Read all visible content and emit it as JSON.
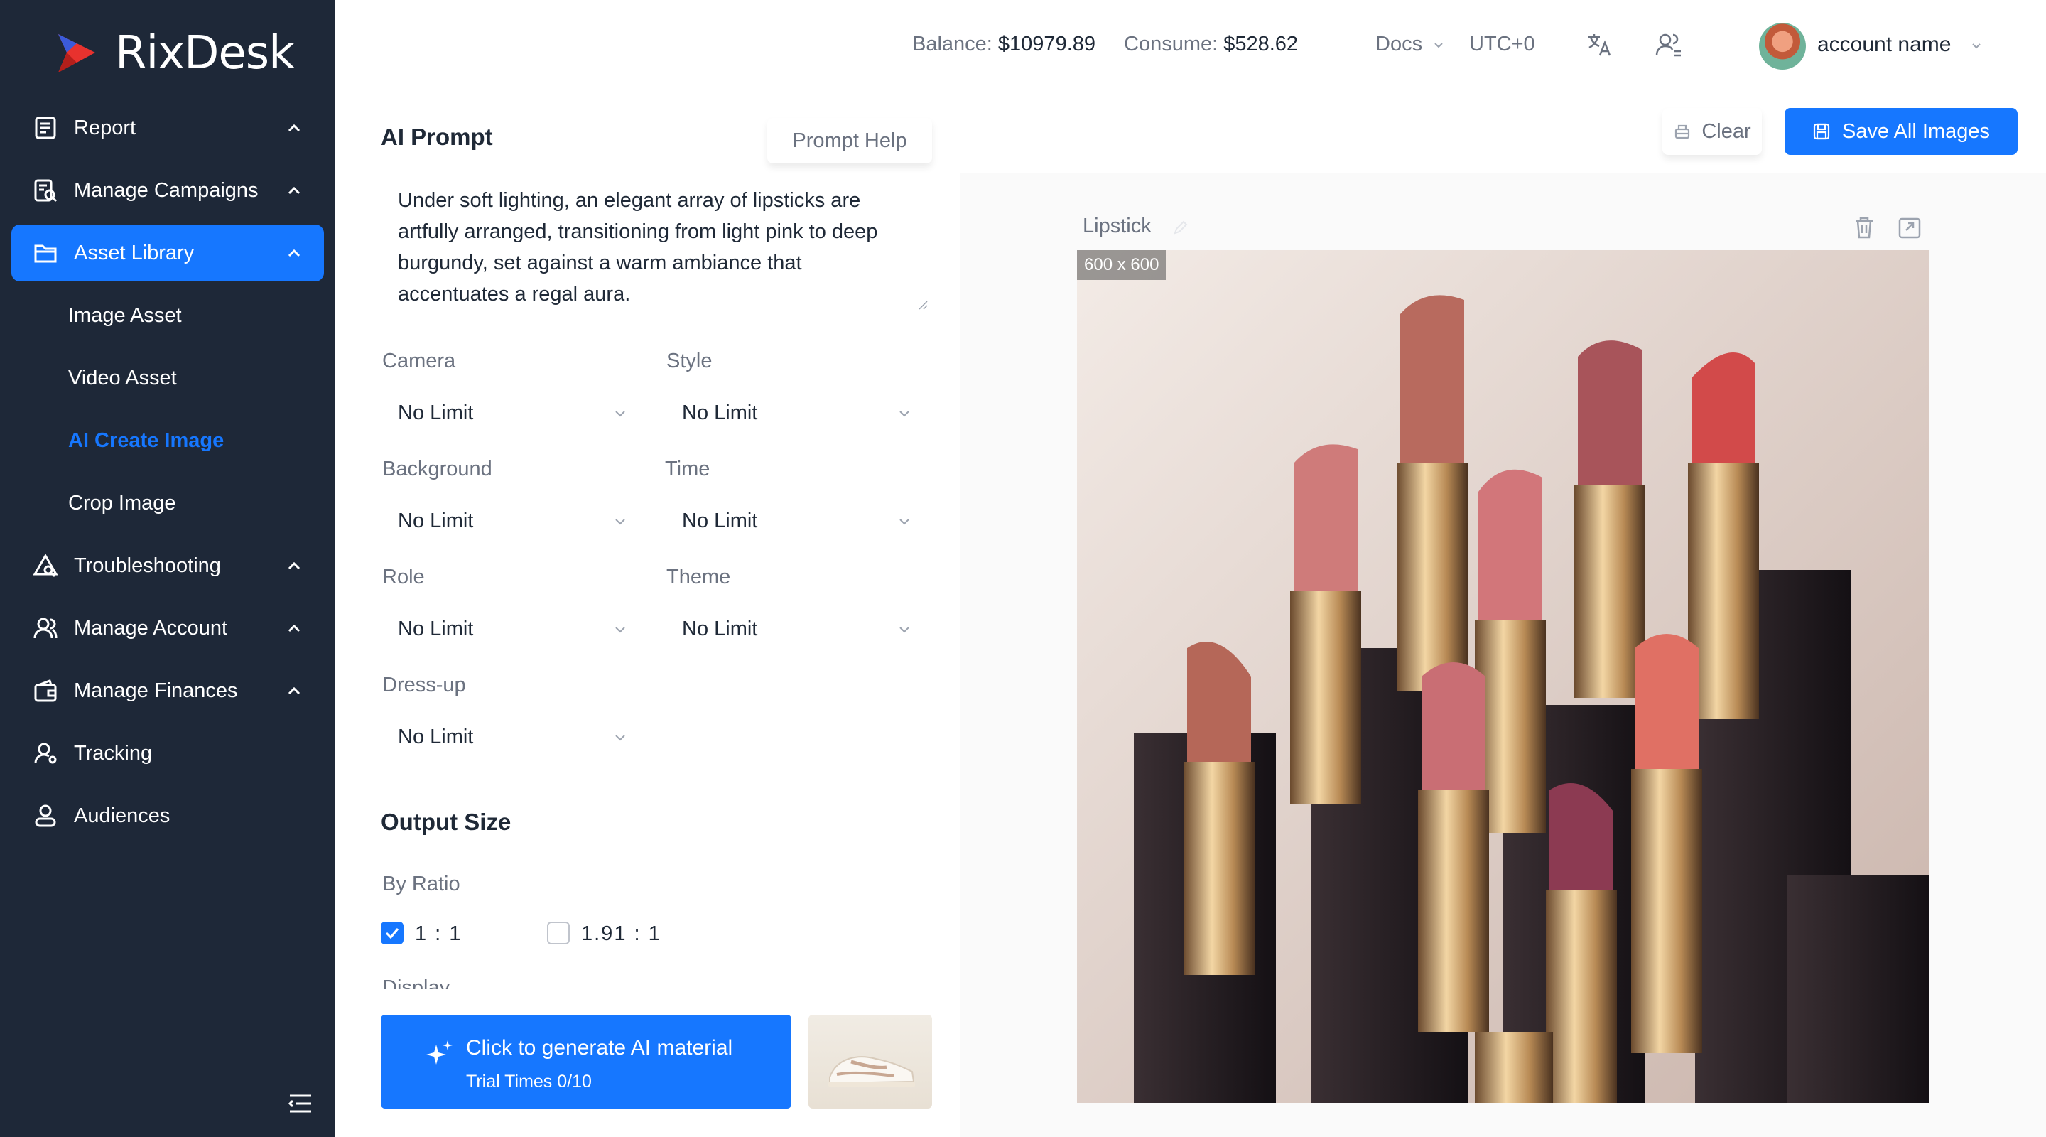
{
  "brand": {
    "name": "RixDesk"
  },
  "sidebar": {
    "items": [
      {
        "label": "Report",
        "icon": "report-icon"
      },
      {
        "label": "Manage Campaigns",
        "icon": "campaign-icon"
      },
      {
        "label": "Asset Library",
        "icon": "folder-icon",
        "active": true,
        "children": [
          {
            "label": "Image Asset"
          },
          {
            "label": "Video Asset"
          },
          {
            "label": "AI Create Image",
            "active": true
          },
          {
            "label": "Crop Image"
          }
        ]
      },
      {
        "label": "Troubleshooting",
        "icon": "troubleshoot-icon"
      },
      {
        "label": "Manage Account",
        "icon": "user-group-icon"
      },
      {
        "label": "Manage Finances",
        "icon": "wallet-icon"
      },
      {
        "label": "Tracking",
        "icon": "tracking-icon"
      },
      {
        "label": "Audiences",
        "icon": "audience-icon"
      }
    ]
  },
  "header": {
    "balance_label": "Balance:",
    "balance_value": "$10979.89",
    "consume_label": "Consume:",
    "consume_value": "$528.62",
    "docs": "Docs",
    "timezone": "UTC+0",
    "account_name": "account name"
  },
  "form": {
    "prompt_title": "AI Prompt",
    "prompt_help": "Prompt Help",
    "prompt_text": "Under soft lighting, an elegant array of lipsticks are artfully arranged, transitioning from light pink to deep burgundy, set against a warm ambiance that accentuates a regal aura.",
    "fields": {
      "camera": {
        "label": "Camera",
        "value": "No Limit"
      },
      "style": {
        "label": "Style",
        "value": "No Limit"
      },
      "background": {
        "label": "Background",
        "value": "No Limit"
      },
      "time": {
        "label": "Time",
        "value": "No Limit"
      },
      "role": {
        "label": "Role",
        "value": "No Limit"
      },
      "theme": {
        "label": "Theme",
        "value": "No Limit"
      },
      "dressup": {
        "label": "Dress-up",
        "value": "No Limit"
      }
    },
    "output_title": "Output Size",
    "by_ratio": "By Ratio",
    "ratio_options": [
      {
        "label": "1 : 1",
        "checked": true
      },
      {
        "label": "1.91 : 1",
        "checked": false
      }
    ],
    "clipped_label": "Display",
    "generate": {
      "title": "Click to generate AI material",
      "subtitle": "Trial Times 0/10"
    }
  },
  "result": {
    "clear_label": "Clear",
    "save_label": "Save All Images",
    "card_title": "Lipstick",
    "size_tag": "600 x 600"
  },
  "colors": {
    "sidebar_bg": "#1e2838",
    "accent": "#1677ff"
  }
}
